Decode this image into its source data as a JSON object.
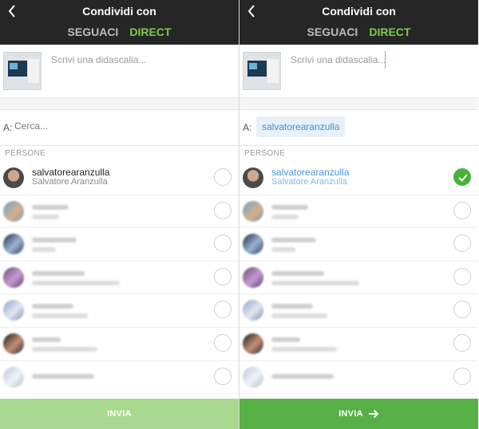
{
  "header": {
    "title": "Condividi con",
    "tabs": [
      "SEGUACI",
      "DIRECT"
    ],
    "active_tab": "DIRECT",
    "back_icon": "chevron-left-icon"
  },
  "caption": {
    "placeholder": "Scrivi una didascalia..."
  },
  "recipients": {
    "to_label": "A:",
    "search_placeholder": "Cerca...",
    "selected_chip": "salvatorearanzulla"
  },
  "people": {
    "section_label": "PERSONE",
    "first": {
      "username": "salvatorearanzulla",
      "full_name": "Salvatore Aranzulla"
    }
  },
  "send": {
    "label": "INVIA"
  },
  "colors": {
    "accent_green": "#7ccc4f",
    "send_disabled": "#a9d98f",
    "send_enabled": "#56b045",
    "link_blue": "#4a95d8",
    "topbar": "#262626"
  }
}
